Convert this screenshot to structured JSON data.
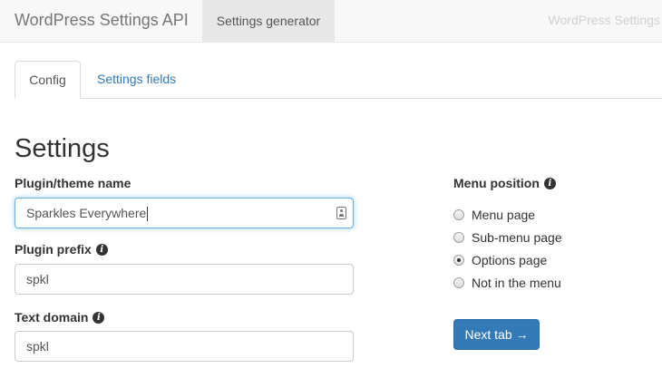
{
  "navbar": {
    "brand": "WordPress Settings API",
    "active_item": "Settings generator",
    "right_text": "WordPress Settings"
  },
  "tabs": [
    {
      "label": "Config",
      "active": true
    },
    {
      "label": "Settings fields",
      "active": false
    }
  ],
  "page_title": "Settings",
  "form": {
    "plugin_name": {
      "label": "Plugin/theme name",
      "value": "Sparkles Everywhere"
    },
    "plugin_prefix": {
      "label": "Plugin prefix",
      "value": "spkl"
    },
    "text_domain": {
      "label": "Text domain",
      "value": "spkl"
    }
  },
  "menu_position": {
    "label": "Menu position",
    "options": [
      {
        "label": "Menu page",
        "checked": false
      },
      {
        "label": "Sub-menu page",
        "checked": false
      },
      {
        "label": "Options page",
        "checked": true
      },
      {
        "label": "Not in the menu",
        "checked": false
      }
    ]
  },
  "next_button": "Next tab →",
  "icons": {
    "info": "info-circle-icon",
    "contact": "contact-card-icon"
  },
  "colors": {
    "primary": "#337ab7",
    "link": "#337ab7",
    "navbar_bg": "#f8f8f8"
  }
}
